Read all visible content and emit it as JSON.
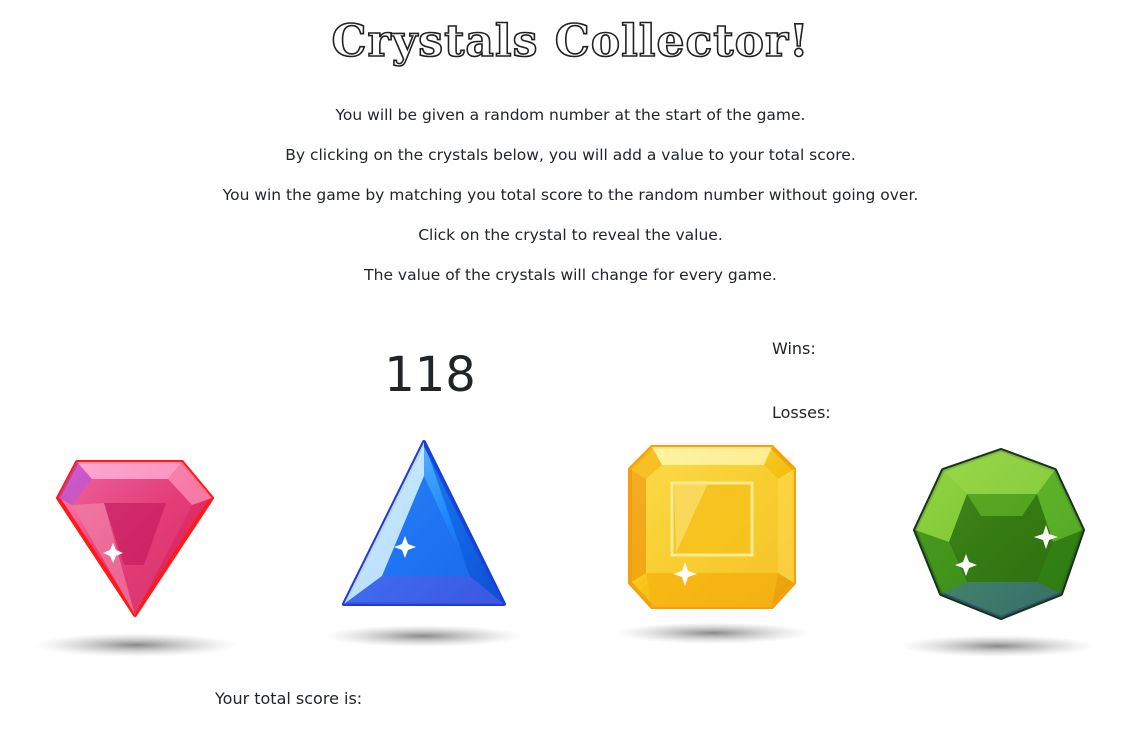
{
  "title": "Crystals Collector!",
  "instructions": [
    "You will be given a random number at the start of the game.",
    "By clicking on the crystals below, you will add a value to your total score.",
    "You win the game by matching you total score to the random number without going over.",
    "Click on the crystal to reveal the value.",
    "The value of the crystals will change for every game."
  ],
  "target_number": "118",
  "stats": {
    "wins_label": "Wins:",
    "losses_label": "Losses:"
  },
  "score_label": "Your total score is:",
  "crystals": [
    {
      "name": "red-crystal",
      "color": "#e8336b"
    },
    {
      "name": "blue-crystal",
      "color": "#1e6ff0"
    },
    {
      "name": "yellow-crystal",
      "color": "#f5c316"
    },
    {
      "name": "green-crystal",
      "color": "#4aa21c"
    }
  ]
}
